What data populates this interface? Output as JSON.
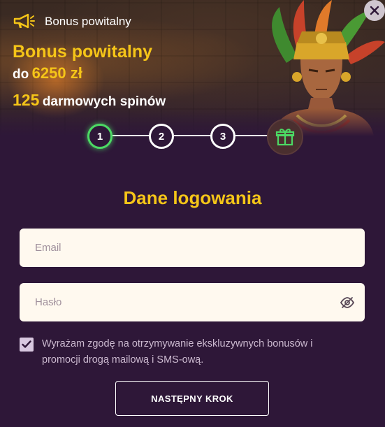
{
  "header": {
    "label": "Bonus powitalny",
    "icon": "megaphone-icon"
  },
  "promo": {
    "title": "Bonus powitalny",
    "amount_prefix": "do",
    "amount": "6250 zł",
    "spins_count": "125",
    "spins_label": "darmowych spinów"
  },
  "steps": {
    "items": [
      "1",
      "2",
      "3"
    ],
    "active": "1",
    "final_icon": "gift-icon"
  },
  "form": {
    "title": "Dane logowania",
    "email_placeholder": "Email",
    "password_placeholder": "Hasło",
    "consent_text": "Wyrażam zgodę na otrzymywanie ekskluzywnych bonusów i promocji drogą mailową i SMS-ową.",
    "consent_checked": true,
    "next_label": "NASTĘPNY KROK"
  },
  "colors": {
    "background": "#2e1738",
    "accent_yellow": "#f5c518",
    "active_step": "#4cd964",
    "field_bg": "#fff9ef"
  }
}
